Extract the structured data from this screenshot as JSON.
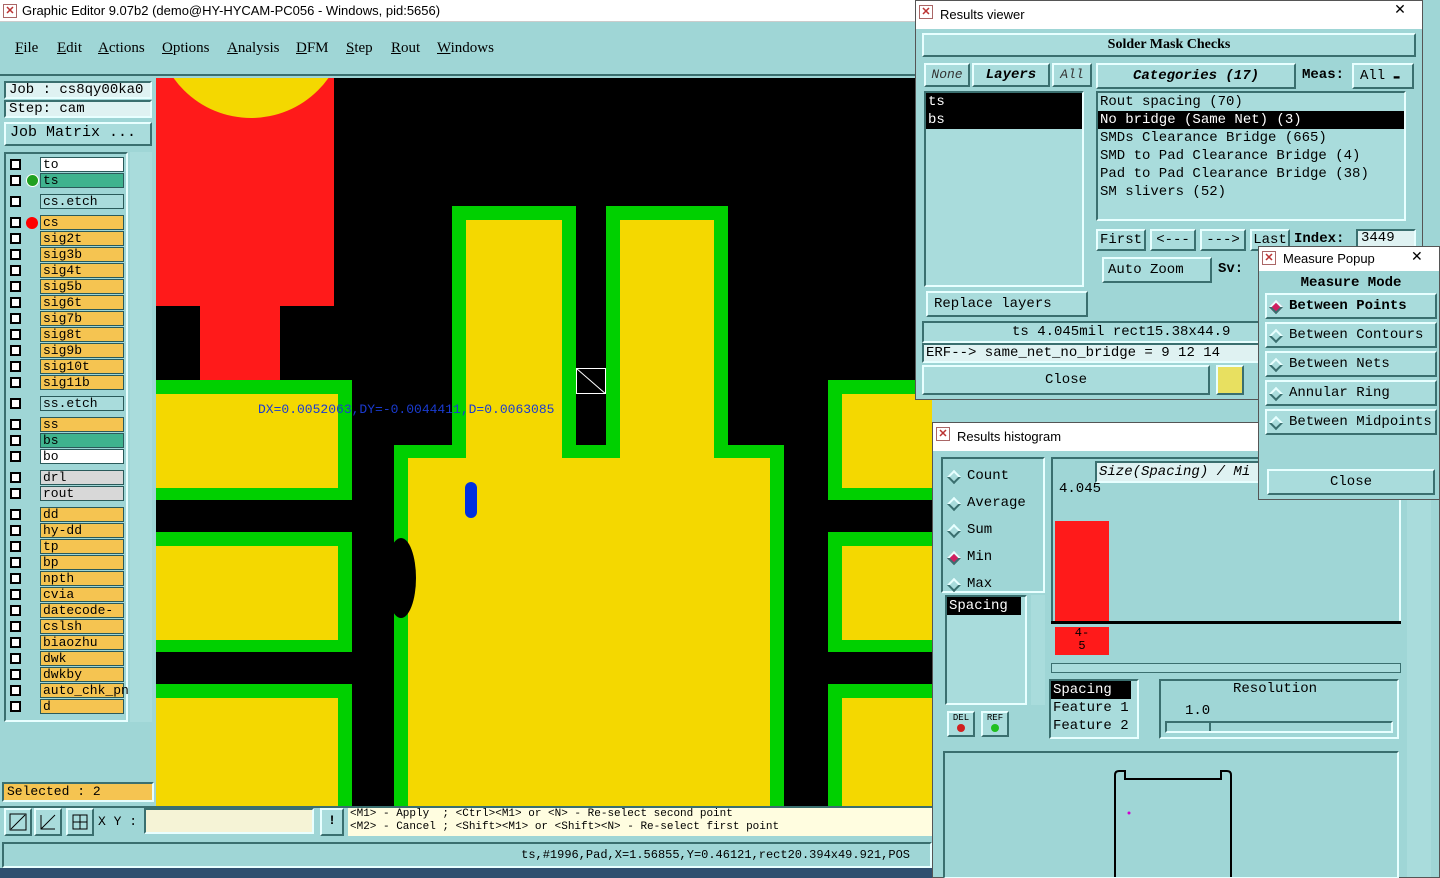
{
  "app": {
    "title": "Graphic Editor 9.07b2 (demo@HY-HYCAM-PC056 - Windows, pid:5656)"
  },
  "menu": [
    "File",
    "Edit",
    "Actions",
    "Options",
    "Analysis",
    "DFM",
    "Step",
    "Rout",
    "Windows"
  ],
  "left": {
    "job": "Job : cs8qy00ka0",
    "step": "Step: cam",
    "job_matrix": "Job Matrix ...",
    "selected": "Selected : 2"
  },
  "layers": [
    {
      "name": "to"
    },
    {
      "name": "ts"
    },
    {
      "name": "cs.etch"
    },
    {
      "name": "cs"
    },
    {
      "name": "sig2t"
    },
    {
      "name": "sig3b"
    },
    {
      "name": "sig4t"
    },
    {
      "name": "sig5b"
    },
    {
      "name": "sig6t"
    },
    {
      "name": "sig7b"
    },
    {
      "name": "sig8t"
    },
    {
      "name": "sig9b"
    },
    {
      "name": "sig10t"
    },
    {
      "name": "sig11b"
    },
    {
      "name": "ss.etch"
    },
    {
      "name": "ss"
    },
    {
      "name": "bs"
    },
    {
      "name": "bo"
    },
    {
      "name": "drl"
    },
    {
      "name": "rout"
    },
    {
      "name": "dd"
    },
    {
      "name": "hy-dd"
    },
    {
      "name": "tp"
    },
    {
      "name": "bp"
    },
    {
      "name": "npth"
    },
    {
      "name": "cvia"
    },
    {
      "name": "datecode-to"
    },
    {
      "name": "cslsh"
    },
    {
      "name": "biaozhu"
    },
    {
      "name": "dwk"
    },
    {
      "name": "dwkby"
    },
    {
      "name": "auto_chk_pn"
    },
    {
      "name": "d"
    }
  ],
  "canvas": {
    "measure_text": "DX=0.0052063,DY=-0.0044411,D=0.0063085"
  },
  "bottom": {
    "xy_label": "X Y :",
    "hint1": "<M1> - Apply  ; <Ctrl><M1> or <N> - Re-select second point",
    "hint2": "<M2> - Cancel ; <Shift><M1> or <Shift><N> - Re-select first point",
    "status": "ts,#1996,Pad,X=1.56855,Y=0.46121,rect20.394x49.921,POS"
  },
  "results_viewer": {
    "title": "Results viewer",
    "header": "Solder Mask Checks",
    "none": "None",
    "layers": "Layers",
    "all": "All",
    "categories_label": "Categories (17)",
    "meas_label": "Meas:",
    "meas_value": "All",
    "layer_items": [
      "ts",
      "bs"
    ],
    "category_items": [
      "Rout spacing (70)",
      "No bridge (Same Net) (3)",
      "SMDs Clearance Bridge (665)",
      "SMD to Pad Clearance Bridge (4)",
      "Pad to Pad Clearance Bridge (38)",
      "SM slivers (52)"
    ],
    "first": "First",
    "prev": "<---",
    "next": "--->",
    "last": "Last",
    "index_label": "Index:",
    "index_value": "3449",
    "auto_zoom": "Auto Zoom",
    "sv": "Sv:",
    "replace_layers": "Replace layers",
    "measure_line": "ts 4.045mil  rect15.38x44.9",
    "erf_line": "ERF--> same_net_no_bridge = 9 12 14",
    "close": "Close"
  },
  "histogram": {
    "title": "Results histogram",
    "modes": [
      "Count",
      "Average",
      "Sum",
      "Min",
      "Max"
    ],
    "selected_mode": "Min",
    "field_item": "Spacing",
    "header": "Size(Spacing) / Mi",
    "bar_value": "4.045",
    "bar_label": "4-\n5",
    "bar_fraction": 0.82,
    "list": [
      "Spacing",
      "Feature 1",
      "Feature 2"
    ],
    "resolution_label": "Resolution",
    "resolution_value": "1.0",
    "del": "DEL",
    "ref": "REF"
  },
  "measure_popup": {
    "title": "Measure Popup",
    "mode_label": "Measure Mode",
    "options": [
      "Between Points",
      "Between Contours",
      "Between Nets",
      "Annular Ring",
      "Between Midpoints"
    ],
    "selected": "Between Points",
    "close": "Close"
  },
  "colors": {
    "bg": "#9fd6d6",
    "yellow": "#f4d800",
    "green": "#00d000",
    "red": "#ff1a1a",
    "bar": "#ff1a1a"
  }
}
